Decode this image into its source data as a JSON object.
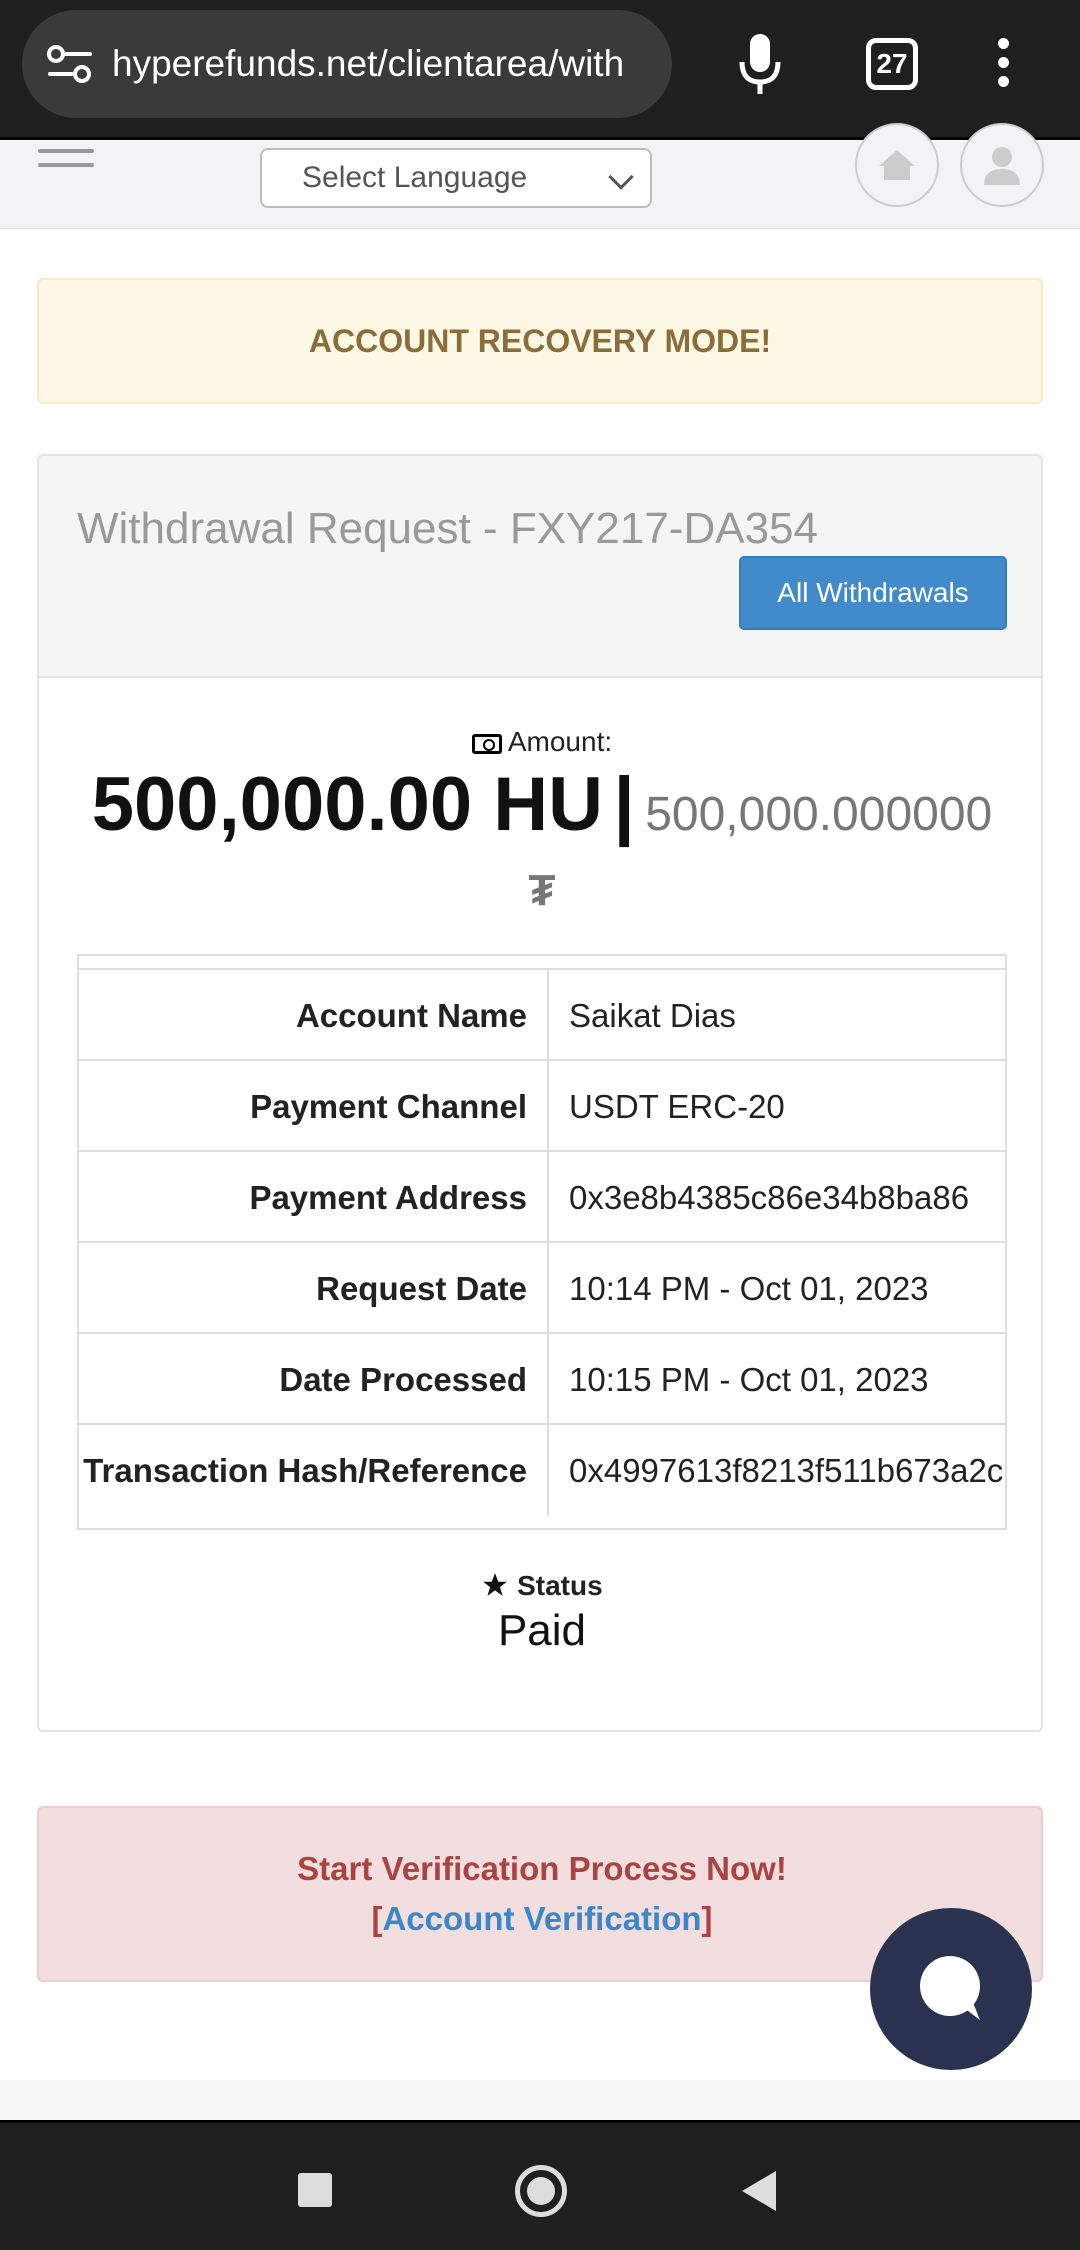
{
  "browser": {
    "url": "hyperefunds.net/clientarea/with",
    "tab_count": "27"
  },
  "header": {
    "language_select": "Select Language"
  },
  "alerts": {
    "recovery": "ACCOUNT RECOVERY MODE!"
  },
  "withdrawal": {
    "title": "Withdrawal Request - FXY217-DA354",
    "all_button": "All Withdrawals",
    "amount_label": "Amount:",
    "amount_main": "500,000.00 HU",
    "separator": "|",
    "amount_crypto": "500,000.000000",
    "crypto_symbol": "₮",
    "rows": [
      {
        "key": "Account Name",
        "value": "Saikat Dias"
      },
      {
        "key": "Payment Channel",
        "value": "USDT ERC-20"
      },
      {
        "key": "Payment Address",
        "value": "0x3e8b4385c86e34b8ba86"
      },
      {
        "key": "Request Date",
        "value": "10:14 PM - Oct 01, 2023"
      },
      {
        "key": "Date Processed",
        "value": "10:15 PM - Oct 01, 2023"
      },
      {
        "key": "Transaction Hash/Reference",
        "value": "0x4997613f8213f511b673a2c"
      }
    ],
    "status_label": "Status",
    "status_value": "Paid"
  },
  "verification": {
    "title": "Start Verification Process Now!",
    "bracket_open": "[",
    "link": "Account Verification",
    "bracket_close": "]"
  },
  "colors": {
    "primary": "#428bca",
    "warning_text": "#8a6d3b",
    "danger_text": "#a94442",
    "chat": "#2a3250"
  }
}
